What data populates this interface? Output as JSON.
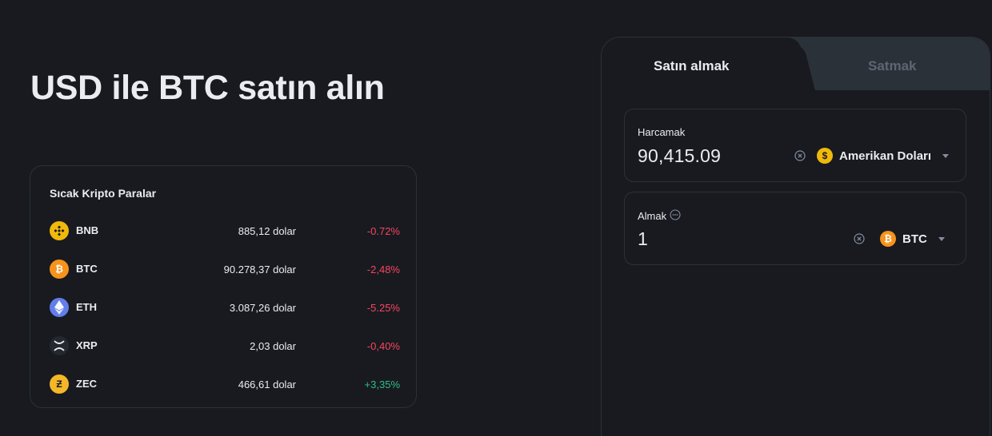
{
  "hero": {
    "title": "USD ile BTC satın alın"
  },
  "hot_cryptos": {
    "title": "Sıcak Kripto Paralar",
    "coins": [
      {
        "symbol": "BNB",
        "price": "885,12 dolar",
        "change": "-0.72%",
        "direction": "down",
        "icon": "bnb-icon",
        "icon_color": "#f0b90b"
      },
      {
        "symbol": "BTC",
        "price": "90.278,37 dolar",
        "change": "-2,48%",
        "direction": "down",
        "icon": "btc-icon",
        "icon_color": "#f7931a"
      },
      {
        "symbol": "ETH",
        "price": "3.087,26 dolar",
        "change": "-5.25%",
        "direction": "down",
        "icon": "eth-icon",
        "icon_color": "#627eea"
      },
      {
        "symbol": "XRP",
        "price": "2,03 dolar",
        "change": "-0,40%",
        "direction": "down",
        "icon": "xrp-icon",
        "icon_color": "#23292f"
      },
      {
        "symbol": "ZEC",
        "price": "466,61 dolar",
        "change": "+3,35%",
        "direction": "up",
        "icon": "zec-icon",
        "icon_color": "#f4b728"
      }
    ]
  },
  "trade": {
    "tabs": {
      "buy": "Satın almak",
      "sell": "Satmak"
    },
    "spend": {
      "label": "Harcamak",
      "value": "90,415.09",
      "currency": "Amerikan Doları",
      "currency_icon": "dollar-coin-icon"
    },
    "receive": {
      "label": "Almak",
      "value": "1",
      "currency": "BTC",
      "currency_icon": "btc-icon"
    }
  },
  "colors": {
    "background": "#181a20",
    "border": "#2b3139",
    "text_primary": "#eaecef",
    "text_muted": "#5e6673",
    "negative": "#f6465d",
    "positive": "#2ebd85",
    "usd_coin": "#f0b90b",
    "btc": "#f7931a"
  }
}
